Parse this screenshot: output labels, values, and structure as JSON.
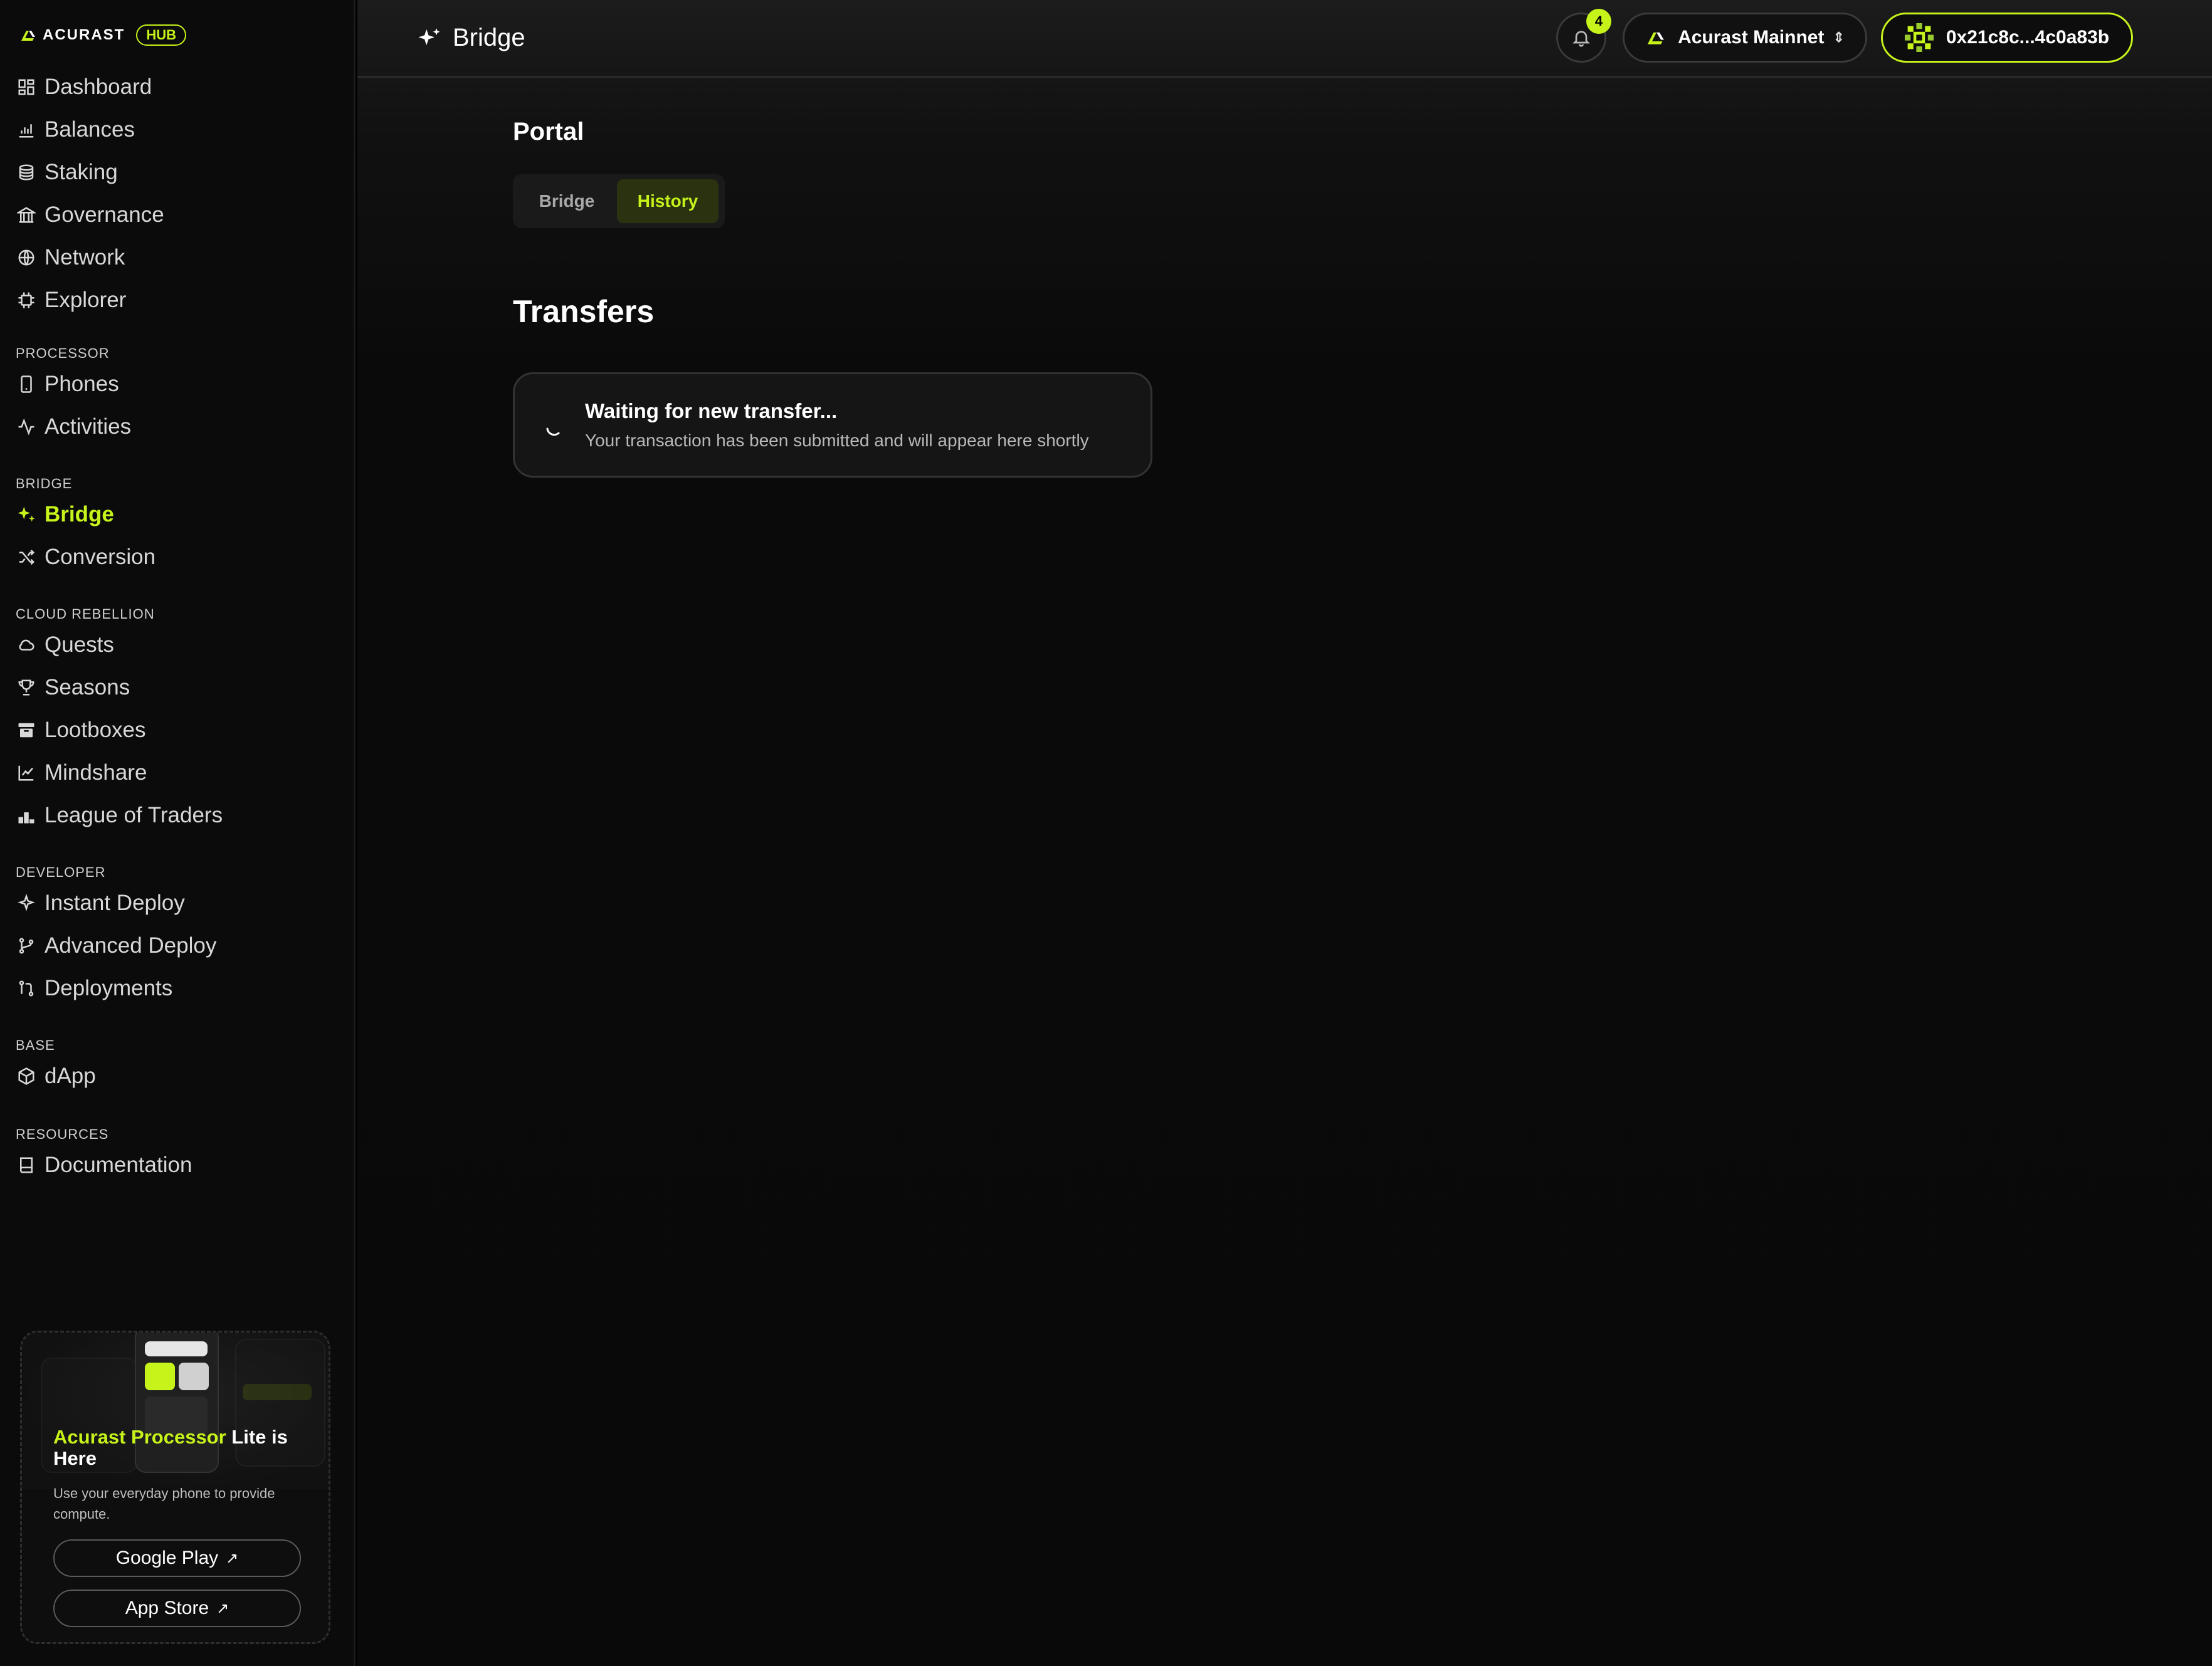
{
  "brand": {
    "name": "ACURAST",
    "badge": "HUB",
    "accent": "#c6f31a"
  },
  "sidebar": {
    "main_items": [
      {
        "label": "Dashboard",
        "icon": "dashboard-icon"
      },
      {
        "label": "Balances",
        "icon": "chart-bar-icon"
      },
      {
        "label": "Staking",
        "icon": "coins-icon"
      },
      {
        "label": "Governance",
        "icon": "landmark-icon"
      },
      {
        "label": "Network",
        "icon": "globe-icon"
      },
      {
        "label": "Explorer",
        "icon": "chip-icon"
      }
    ],
    "processor": {
      "heading": "PROCESSOR",
      "items": [
        {
          "label": "Phones"
        },
        {
          "label": "Activities"
        }
      ]
    },
    "bridge": {
      "heading": "BRIDGE",
      "items": [
        {
          "label": "Bridge"
        },
        {
          "label": "Conversion"
        }
      ]
    },
    "cloud_rebellion": {
      "heading": "CLOUD REBELLION",
      "items": [
        {
          "label": "Quests"
        },
        {
          "label": "Seasons"
        },
        {
          "label": "Lootboxes"
        },
        {
          "label": "Mindshare"
        },
        {
          "label": "League of Traders"
        }
      ]
    },
    "developer": {
      "heading": "DEVELOPER",
      "items": [
        {
          "label": "Instant Deploy"
        },
        {
          "label": "Advanced Deploy"
        },
        {
          "label": "Deployments"
        }
      ]
    },
    "base": {
      "heading": "BASE",
      "items": [
        {
          "label": "dApp"
        }
      ]
    },
    "resources": {
      "heading": "RESOURCES",
      "items": [
        {
          "label": "Documentation"
        }
      ]
    },
    "active": "Bridge"
  },
  "promo": {
    "title_highlight": "Acurast Processor",
    "title_rest": " Lite is Here",
    "description": "Use your everyday phone to provide compute.",
    "google_play": "Google Play",
    "app_store": "App Store",
    "arrow": "↗"
  },
  "header": {
    "title": "Bridge",
    "notification_count": "4",
    "network": "Acurast Mainnet",
    "wallet": "0x21c8c...4c0a83b"
  },
  "portal": {
    "title": "Portal",
    "tabs": [
      {
        "label": "Bridge",
        "active": false
      },
      {
        "label": "History",
        "active": true
      }
    ]
  },
  "transfers": {
    "title": "Transfers",
    "card_title": "Waiting for new transfer...",
    "card_subtitle": "Your transaction has been submitted and will appear here shortly"
  }
}
